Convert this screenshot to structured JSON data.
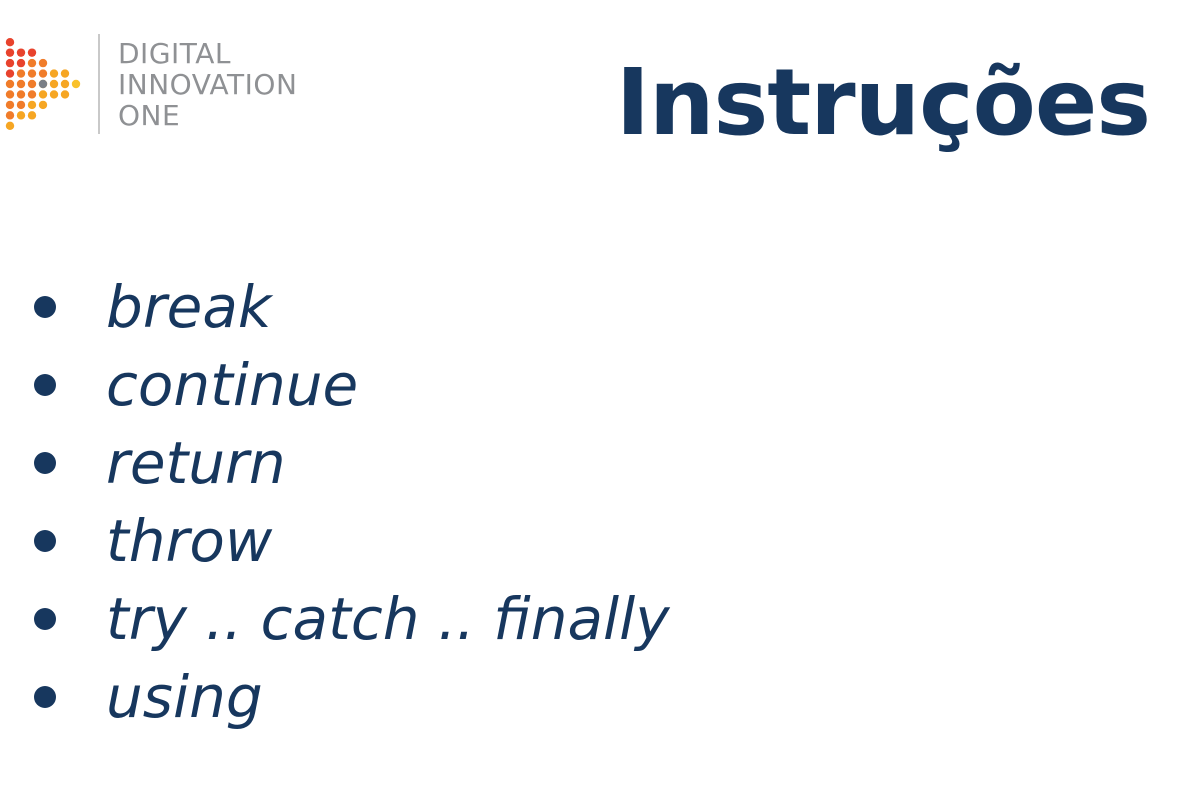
{
  "logo": {
    "lines": [
      "DIGITAL",
      "INNOVATION",
      "ONE"
    ],
    "icon": "play-triangle-dots-icon",
    "colors": [
      "#e8432d",
      "#f07c2a",
      "#f6a623",
      "#f9c12b"
    ]
  },
  "title": "Instruções",
  "bullets": [
    "break",
    "continue",
    "return",
    "throw",
    "try .. catch .. finally",
    "using"
  ],
  "colors": {
    "text": "#17375e",
    "logo_text": "#8f9194"
  }
}
